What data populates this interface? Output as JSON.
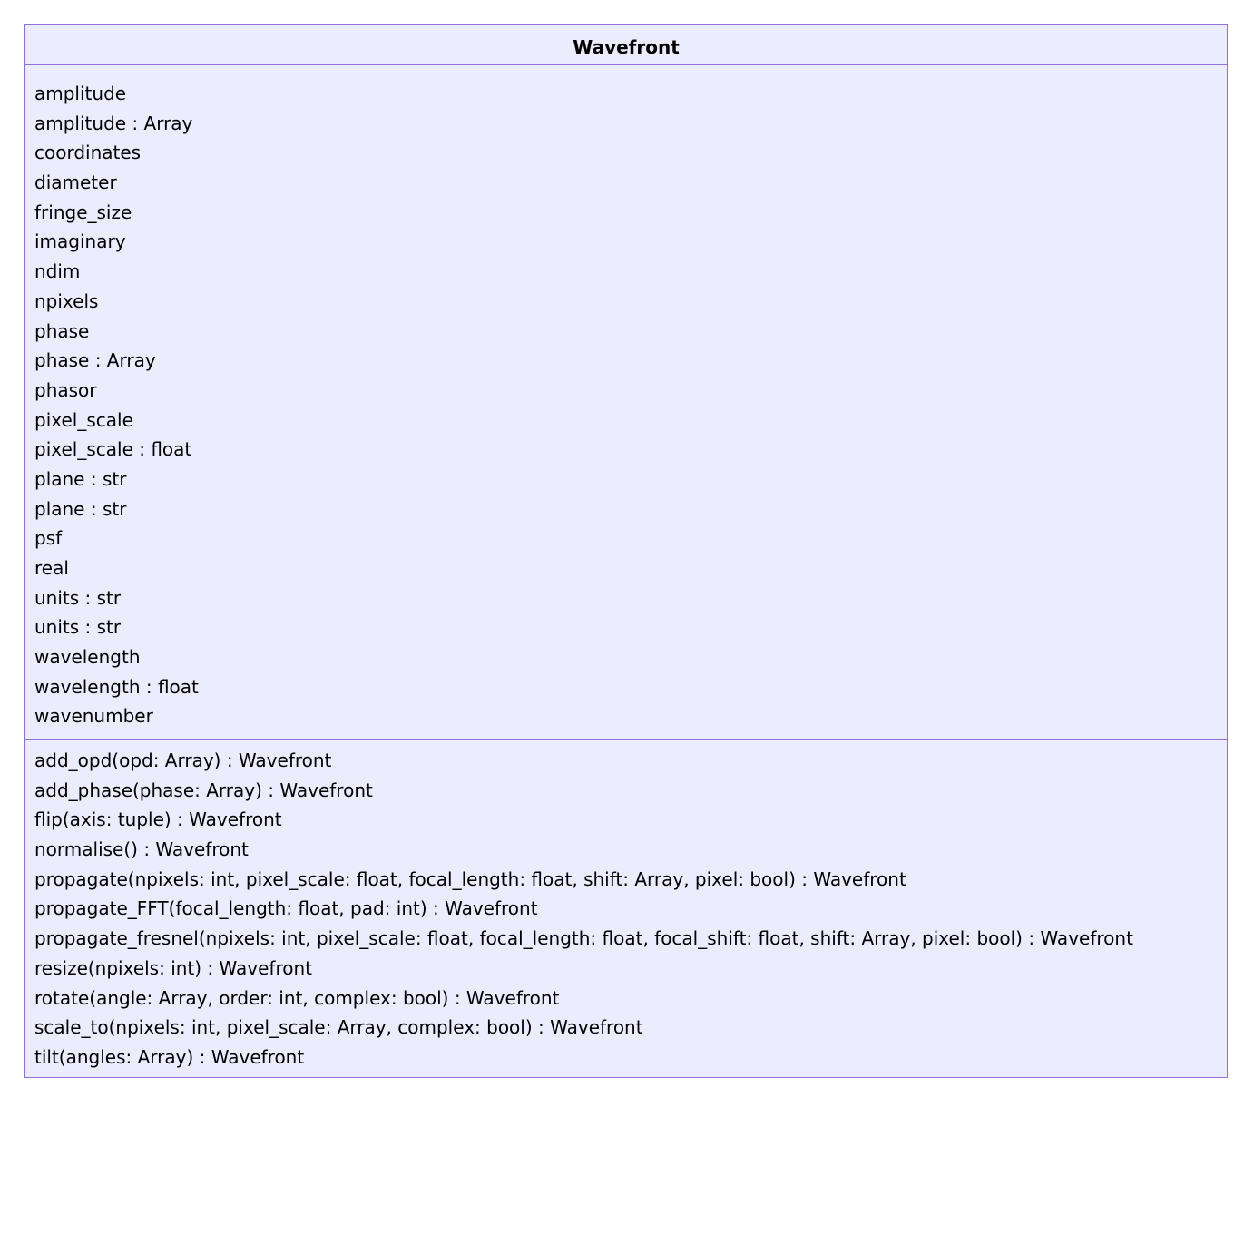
{
  "class": {
    "name": "Wavefront",
    "attributes": [
      "amplitude",
      "amplitude : Array",
      "coordinates",
      "diameter",
      "fringe_size",
      "imaginary",
      "ndim",
      "npixels",
      "phase",
      "phase : Array",
      "phasor",
      "pixel_scale",
      "pixel_scale : float",
      "plane : str",
      "plane : str",
      "psf",
      "real",
      "units : str",
      "units : str",
      "wavelength",
      "wavelength : float",
      "wavenumber"
    ],
    "methods": [
      "add_opd(opd: Array) : Wavefront",
      "add_phase(phase: Array) : Wavefront",
      "flip(axis: tuple) : Wavefront",
      "normalise() : Wavefront",
      "propagate(npixels: int, pixel_scale: float, focal_length: float, shift: Array, pixel: bool) : Wavefront",
      "propagate_FFT(focal_length: float, pad: int) : Wavefront",
      "propagate_fresnel(npixels: int, pixel_scale: float, focal_length: float, focal_shift: float, shift: Array, pixel: bool) : Wavefront",
      "resize(npixels: int) : Wavefront",
      "rotate(angle: Array, order: int, complex: bool) : Wavefront",
      "scale_to(npixels: int, pixel_scale: Array, complex: bool) : Wavefront",
      "tilt(angles: Array) : Wavefront"
    ]
  },
  "colors": {
    "box_fill": "#ececff",
    "box_border": "#9370db",
    "text": "#000000"
  }
}
